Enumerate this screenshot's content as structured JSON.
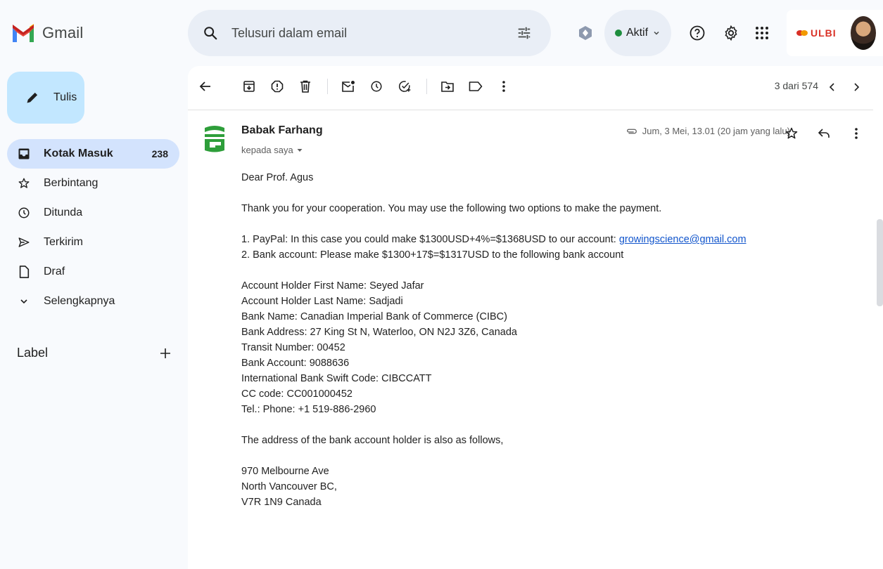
{
  "app": {
    "name": "Gmail"
  },
  "search": {
    "placeholder": "Telusuri dalam email"
  },
  "status": {
    "label": "Aktif"
  },
  "org": {
    "name": "ULBI"
  },
  "sidebar": {
    "compose_label": "Tulis",
    "items": [
      {
        "label": "Kotak Masuk",
        "count": "238",
        "icon": "inbox-icon"
      },
      {
        "label": "Berbintang",
        "icon": "star-icon"
      },
      {
        "label": "Ditunda",
        "icon": "clock-icon"
      },
      {
        "label": "Terkirim",
        "icon": "send-icon"
      },
      {
        "label": "Draf",
        "icon": "draft-icon"
      },
      {
        "label": "Selengkapnya",
        "icon": "chevron-down-icon"
      }
    ],
    "label_heading": "Label"
  },
  "toolbar": {
    "pager": "3 dari 574"
  },
  "email": {
    "sender": "Babak Farhang",
    "recipient": "kepada saya",
    "date": "Jum, 3 Mei, 13.01 (20 jam yang lalu)",
    "greeting": "Dear Prof. Agus",
    "intro": "Thank you for your cooperation. You may use the following two options to make the payment.",
    "option1_text": "1. PayPal: In this case you could make $1300USD+4%=$1368USD to our account: ",
    "option1_link": "growingscience@gmail.com",
    "option2": "2. Bank account: Please make $1300+17$=$1317USD to the following bank account",
    "bank_details": [
      "Account Holder First Name: Seyed Jafar",
      "Account Holder Last Name: Sadjadi",
      "Bank Name: Canadian Imperial Bank of Commerce  (CIBC)",
      "Bank Address: 27 King St N, Waterloo, ON N2J 3Z6, Canada",
      "Transit Number: 00452",
      "Bank Account: 9088636",
      "International Bank Swift Code: CIBCCATT",
      "CC code: CC001000452",
      "Tel.: Phone: +1 519-886-2960"
    ],
    "address_intro": "The address of the bank account holder is also as follows,",
    "address": [
      "970 Melbourne Ave",
      "North Vancouver BC,",
      "V7R 1N9 Canada"
    ]
  },
  "colors": {
    "accent": "#c2e7ff",
    "active_nav": "#d3e3fd",
    "search_bg": "#e9eef6",
    "link": "#1155cc",
    "status_green": "#1e8e3e"
  }
}
